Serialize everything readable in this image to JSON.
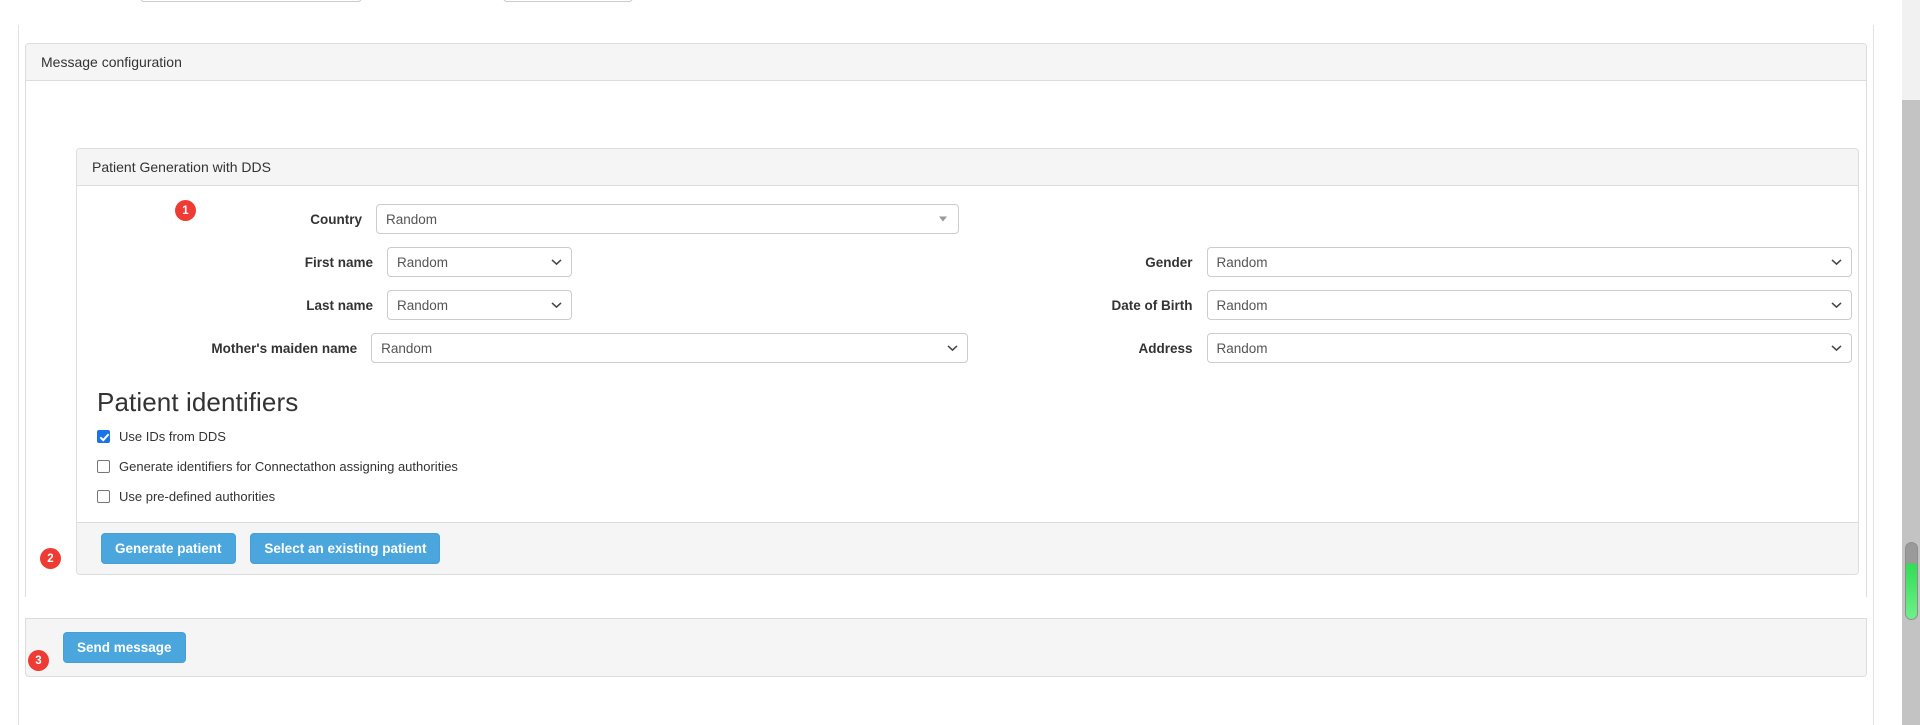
{
  "panels": {
    "message_configuration": {
      "title": "Message configuration"
    },
    "patient_generation": {
      "title": "Patient Generation with DDS"
    }
  },
  "form": {
    "left": [
      {
        "label": "Country",
        "value": "Random",
        "control": "select-bs"
      },
      {
        "label": "First name",
        "value": "Random",
        "control": "select"
      },
      {
        "label": "Last name",
        "value": "Random",
        "control": "select"
      },
      {
        "label": "Mother's maiden name",
        "value": "Random",
        "control": "select"
      }
    ],
    "right": [
      {
        "label": "Gender",
        "value": "Random",
        "control": "select"
      },
      {
        "label": "Date of Birth",
        "value": "Random",
        "control": "select"
      },
      {
        "label": "Address",
        "value": "Random",
        "control": "select"
      }
    ]
  },
  "identifiers": {
    "heading": "Patient identifiers",
    "options": [
      {
        "label": "Use IDs from DDS",
        "checked": true
      },
      {
        "label": "Generate identifiers for Connectathon assigning authorities",
        "checked": false
      },
      {
        "label": "Use pre-defined authorities",
        "checked": false
      }
    ]
  },
  "buttons": {
    "generate_patient": "Generate patient",
    "select_existing_patient": "Select an existing patient",
    "send_message": "Send message"
  },
  "badges": {
    "one": "1",
    "two": "2",
    "three": "3"
  },
  "colors": {
    "button_blue": "#4ba6dd",
    "badge_red": "#ee3b33",
    "checkbox_blue": "#1a73e8",
    "panel_header_gray": "#f5f5f5",
    "scroll_thumb_green": "#33dd55"
  }
}
